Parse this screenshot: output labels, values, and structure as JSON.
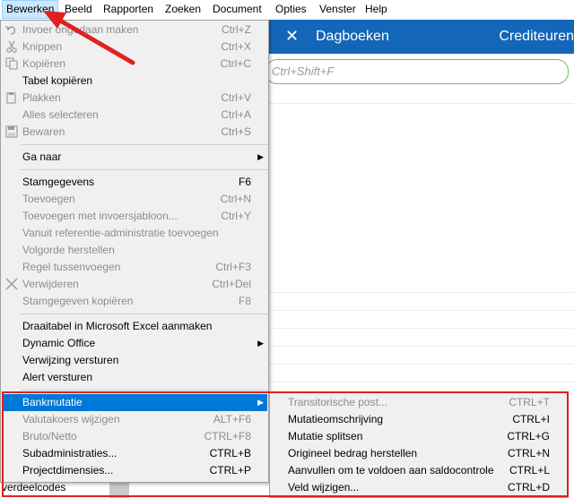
{
  "menubar": {
    "items": [
      "Bewerken",
      "Beeld",
      "Rapporten",
      "Zoeken",
      "Document",
      "Opties",
      "Venster",
      "Help"
    ]
  },
  "app": {
    "close_glyph": "✕",
    "title": "Dagboeken",
    "title_right": "Crediteuren",
    "search_placeholder": "Ctrl+Shift+F"
  },
  "background": {
    "list_text": "verdeelcodes"
  },
  "menu": {
    "items": [
      {
        "label": "Invoer ongedaan maken",
        "shortcut": "Ctrl+Z",
        "enabled": false,
        "icon": "undo-icon"
      },
      {
        "label": "Knippen",
        "shortcut": "Ctrl+X",
        "enabled": false,
        "icon": "scissors-icon"
      },
      {
        "label": "Kopiëren",
        "shortcut": "Ctrl+C",
        "enabled": false,
        "icon": "copy-icon"
      },
      {
        "label": "Tabel kopiëren",
        "shortcut": "",
        "enabled": true,
        "icon": ""
      },
      {
        "label": "Plakken",
        "shortcut": "Ctrl+V",
        "enabled": false,
        "icon": "paste-icon"
      },
      {
        "label": "Alles selecteren",
        "shortcut": "Ctrl+A",
        "enabled": false,
        "icon": ""
      },
      {
        "label": "Bewaren",
        "shortcut": "Ctrl+S",
        "enabled": false,
        "icon": "save-icon"
      },
      {
        "label": "Ga naar",
        "shortcut": "",
        "enabled": true,
        "submenu": true
      },
      {
        "label": "Stamgegevens",
        "shortcut": "F6",
        "enabled": true
      },
      {
        "label": "Toevoegen",
        "shortcut": "Ctrl+N",
        "enabled": false
      },
      {
        "label": "Toevoegen met invoersjabloon...",
        "shortcut": "Ctrl+Y",
        "enabled": false
      },
      {
        "label": "Vanuit referentie-administratie toevoegen",
        "shortcut": "",
        "enabled": false
      },
      {
        "label": "Volgorde herstellen",
        "shortcut": "",
        "enabled": false
      },
      {
        "label": "Regel tussenvoegen",
        "shortcut": "Ctrl+F3",
        "enabled": false
      },
      {
        "label": "Verwijderen",
        "shortcut": "Ctrl+Del",
        "enabled": false,
        "icon": "delete-x-icon"
      },
      {
        "label": "Stamgegeven kopiëren",
        "shortcut": "F8",
        "enabled": false
      },
      {
        "label": "Draaitabel in Microsoft Excel aanmaken",
        "shortcut": "",
        "enabled": true
      },
      {
        "label": "Dynamic Office",
        "shortcut": "",
        "enabled": true,
        "submenu": true
      },
      {
        "label": "Verwijzing versturen",
        "shortcut": "",
        "enabled": true
      },
      {
        "label": "Alert versturen",
        "shortcut": "",
        "enabled": true
      },
      {
        "label": "Bankmutatie",
        "shortcut": "",
        "enabled": true,
        "submenu": true,
        "highlighted": true
      },
      {
        "label": "Valutakoers wijzigen",
        "shortcut": "ALT+F6",
        "enabled": false
      },
      {
        "label": "Bruto/Netto",
        "shortcut": "CTRL+F8",
        "enabled": false
      },
      {
        "label": "Subadministraties...",
        "shortcut": "CTRL+B",
        "enabled": true
      },
      {
        "label": "Projectdimensies...",
        "shortcut": "CTRL+P",
        "enabled": true
      }
    ]
  },
  "submenu": {
    "items": [
      {
        "label": "Transitorische post...",
        "shortcut": "CTRL+T",
        "enabled": false
      },
      {
        "label": "Mutatieomschrijving",
        "shortcut": "CTRL+I",
        "enabled": true
      },
      {
        "label": "Mutatie splitsen",
        "shortcut": "CTRL+G",
        "enabled": true
      },
      {
        "label": "Origineel bedrag herstellen",
        "shortcut": "CTRL+N",
        "enabled": true
      },
      {
        "label": "Aanvullen om te voldoen aan saldocontrole",
        "shortcut": "CTRL+L",
        "enabled": true
      },
      {
        "label": "Veld wijzigen...",
        "shortcut": "CTRL+D",
        "enabled": true
      }
    ]
  },
  "colors": {
    "accent": "#1466b8",
    "highlight": "#0078d7",
    "annotation": "#e02020"
  }
}
